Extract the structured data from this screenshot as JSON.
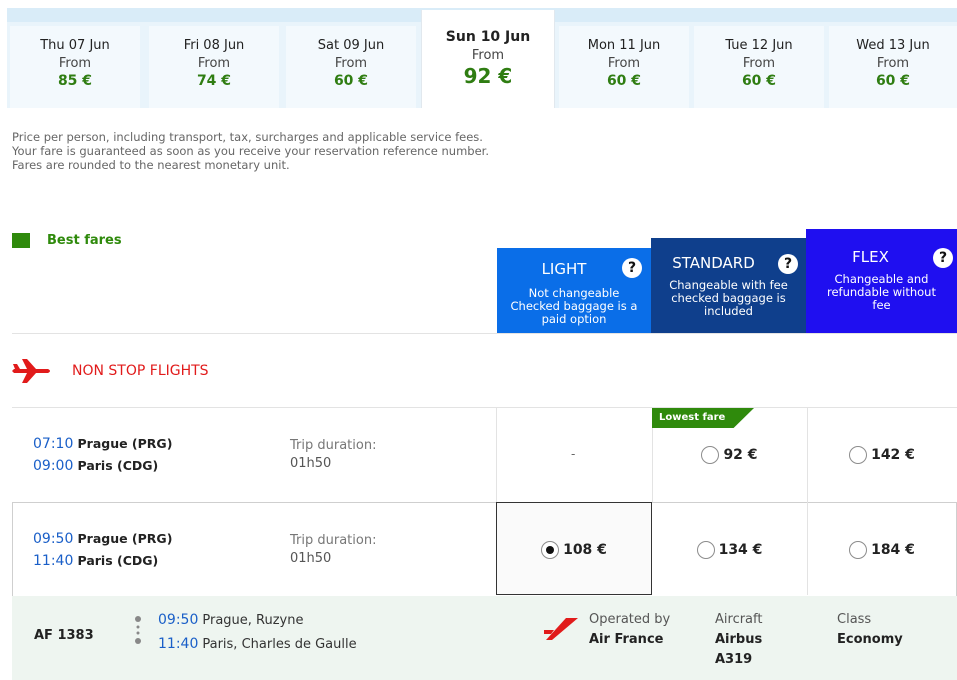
{
  "dates": [
    {
      "day": "Thu 07 Jun",
      "from": "From",
      "price": "85 €",
      "selected": false
    },
    {
      "day": "Fri 08 Jun",
      "from": "From",
      "price": "74 €",
      "selected": false
    },
    {
      "day": "Sat 09 Jun",
      "from": "From",
      "price": "60 €",
      "selected": false
    },
    {
      "day": "Sun 10 Jun",
      "from": "From",
      "price": "92 €",
      "selected": true
    },
    {
      "day": "Mon 11 Jun",
      "from": "From",
      "price": "60 €",
      "selected": false
    },
    {
      "day": "Tue 12 Jun",
      "from": "From",
      "price": "60 €",
      "selected": false
    },
    {
      "day": "Wed 13 Jun",
      "from": "From",
      "price": "60 €",
      "selected": false
    }
  ],
  "info": {
    "line1": "Price per person, including transport, tax, surcharges and applicable service fees.",
    "line2": "Your fare is guaranteed as soon as you receive your reservation reference number.",
    "line3": "Fares are rounded to the nearest monetary unit."
  },
  "best_fares_label": "Best fares",
  "fares": {
    "light": {
      "name": "LIGHT",
      "desc1": "Not changeable",
      "desc2": "Checked baggage is a",
      "desc3": "paid option",
      "help": "?"
    },
    "standard": {
      "name": "STANDARD",
      "desc1": "Changeable with fee",
      "desc2": "checked baggage is",
      "desc3": "included",
      "help": "?"
    },
    "flex": {
      "name": "FLEX",
      "desc1": "Changeable and",
      "desc2": "refundable without",
      "desc3": "fee",
      "help": "?"
    }
  },
  "section_title": "NON STOP FLIGHTS",
  "lowest_fare_label": "Lowest fare",
  "flights": [
    {
      "dep_time": "07:10",
      "dep_city": "Prague (PRG)",
      "arr_time": "09:00",
      "arr_city": "Paris (CDG)",
      "duration_label": "Trip duration:",
      "duration": "01h50",
      "light": "-",
      "standard": "92 €",
      "flex": "142 €"
    },
    {
      "dep_time": "09:50",
      "dep_city": "Prague (PRG)",
      "arr_time": "11:40",
      "arr_city": "Paris (CDG)",
      "duration_label": "Trip duration:",
      "duration": "01h50",
      "light": "108 €",
      "standard": "134 €",
      "flex": "184 €"
    }
  ],
  "detail": {
    "flight_number": "AF 1383",
    "dep_time": "09:50",
    "dep_place": "Prague, Ruzyne",
    "arr_time": "11:40",
    "arr_place": "Paris, Charles de Gaulle",
    "operated_label": "Operated by",
    "operator": "Air France",
    "aircraft_label": "Aircraft",
    "aircraft_1": "Airbus",
    "aircraft_2": "A319",
    "class_label": "Class",
    "class": "Economy"
  },
  "colors": {
    "accent_green": "#2f8a0c",
    "link_blue": "#1a5fc8",
    "red": "#e11b1b",
    "light": "#0a6ee8",
    "standard": "#0f3f8c",
    "flex": "#1f0ff0"
  }
}
